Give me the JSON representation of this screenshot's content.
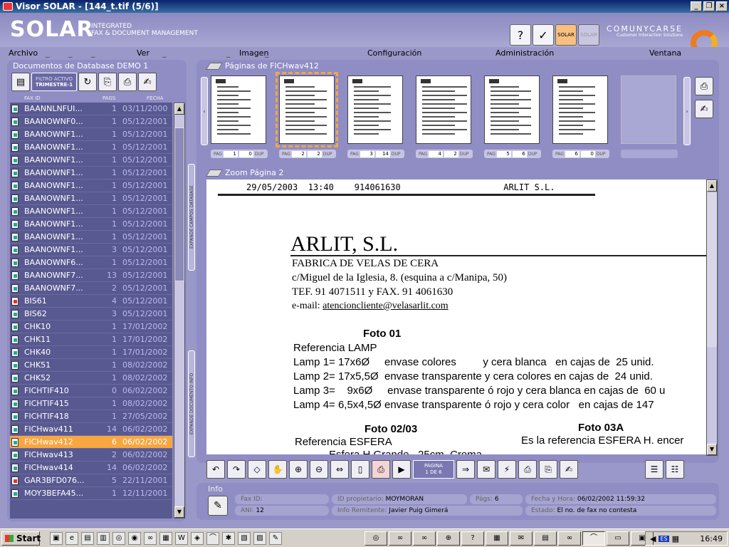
{
  "window": {
    "title": "Visor SOLAR - [144_t.tif (5/6)]"
  },
  "header": {
    "logo": "SOLAR",
    "logo_sub1": "INTEGRATED",
    "logo_sub2": "FAX & DOCUMENT MANAGEMENT",
    "brand": "COMUNYCARSE",
    "brand_sub": "Customer Interaction Solutions",
    "tool_icons": [
      "help-icon",
      "check-icon",
      "solar-icon",
      "solar-disabled-icon"
    ],
    "tool_label": "SOLAR"
  },
  "menu": [
    "Archivo",
    "Ver",
    "Imagen",
    "Configuración",
    "Administración",
    "Ventana"
  ],
  "left": {
    "title": "Documentos de Database DEMO 1",
    "filter_label": "FILTRO ACTIVO",
    "filter_value": "TRIMESTRE-1",
    "col_id": "FAX ID",
    "col_pages": "PAGS",
    "col_date": "FECHA",
    "expand_db": "EXPANDE CAMPOS DATABASE",
    "expand_info": "EXPANDE DOCUMENTO INFO",
    "rows": [
      {
        "name": "BAANNLNFUI...",
        "pages": "1",
        "date": "03/11/2000",
        "red": false
      },
      {
        "name": "BAANOWNF0...",
        "pages": "1",
        "date": "05/12/2001",
        "red": false
      },
      {
        "name": "BAANOWNF1...",
        "pages": "1",
        "date": "05/12/2001",
        "red": false
      },
      {
        "name": "BAANOWNF1...",
        "pages": "1",
        "date": "05/12/2001",
        "red": false
      },
      {
        "name": "BAANOWNF1...",
        "pages": "1",
        "date": "05/12/2001",
        "red": false
      },
      {
        "name": "BAANOWNF1...",
        "pages": "1",
        "date": "05/12/2001",
        "red": false
      },
      {
        "name": "BAANOWNF1...",
        "pages": "1",
        "date": "05/12/2001",
        "red": false
      },
      {
        "name": "BAANOWNF1...",
        "pages": "1",
        "date": "05/12/2001",
        "red": false
      },
      {
        "name": "BAANOWNF1...",
        "pages": "1",
        "date": "05/12/2001",
        "red": false
      },
      {
        "name": "BAANOWNF1...",
        "pages": "1",
        "date": "05/12/2001",
        "red": false
      },
      {
        "name": "BAANOWNF1...",
        "pages": "1",
        "date": "05/12/2001",
        "red": false
      },
      {
        "name": "BAANOWNF1...",
        "pages": "3",
        "date": "05/12/2001",
        "red": false
      },
      {
        "name": "BAANOWNF6...",
        "pages": "1",
        "date": "05/12/2001",
        "red": false
      },
      {
        "name": "BAANOWNF7...",
        "pages": "13",
        "date": "05/12/2001",
        "red": false
      },
      {
        "name": "BAANOWNF7...",
        "pages": "2",
        "date": "05/12/2001",
        "red": false
      },
      {
        "name": "BIS61",
        "pages": "4",
        "date": "05/12/2001",
        "red": true
      },
      {
        "name": "BIS62",
        "pages": "3",
        "date": "05/12/2001",
        "red": false
      },
      {
        "name": "CHK10",
        "pages": "1",
        "date": "17/01/2002",
        "red": false
      },
      {
        "name": "CHK11",
        "pages": "1",
        "date": "17/01/2002",
        "red": false
      },
      {
        "name": "CHK40",
        "pages": "1",
        "date": "17/01/2002",
        "red": false
      },
      {
        "name": "CHK51",
        "pages": "1",
        "date": "08/02/2002",
        "red": false
      },
      {
        "name": "CHK52",
        "pages": "1",
        "date": "08/02/2002",
        "red": false
      },
      {
        "name": "FICHTIF410",
        "pages": "0",
        "date": "06/02/2002",
        "red": false
      },
      {
        "name": "FICHTIF415",
        "pages": "1",
        "date": "08/02/2002",
        "red": false
      },
      {
        "name": "FICHTIF418",
        "pages": "1",
        "date": "27/05/2002",
        "red": false
      },
      {
        "name": "FICHwav411",
        "pages": "14",
        "date": "06/02/2002",
        "red": false
      },
      {
        "name": "FICHwav412",
        "pages": "6",
        "date": "06/02/2002",
        "red": false,
        "selected": true
      },
      {
        "name": "FICHwav413",
        "pages": "2",
        "date": "06/02/2002",
        "red": false
      },
      {
        "name": "FICHwav414",
        "pages": "14",
        "date": "06/02/2002",
        "red": false
      },
      {
        "name": "GAR3BFD076...",
        "pages": "5",
        "date": "22/11/2001",
        "red": true
      },
      {
        "name": "MOY3BEFA45...",
        "pages": "1",
        "date": "12/11/2001",
        "red": false
      }
    ]
  },
  "pages": {
    "title": "Páginas de FICHwav412",
    "pag_label": "PAG",
    "dup_label": "DUP",
    "thumbs": [
      {
        "page": "1",
        "dup": "0",
        "selected": false
      },
      {
        "page": "2",
        "dup": "2",
        "selected": true
      },
      {
        "page": "3",
        "dup": "14",
        "selected": false
      },
      {
        "page": "4",
        "dup": "2",
        "selected": false
      },
      {
        "page": "5",
        "dup": "6",
        "selected": false
      },
      {
        "page": "6",
        "dup": "0",
        "selected": false
      }
    ]
  },
  "zoom": {
    "title": "Zoom Página 2",
    "header_line": "29/05/2003  13:40    914061630                    ARLIT S.L.",
    "company": "ARLIT, S.L.",
    "line1": "FABRICA DE VELAS DE CERA",
    "line2": "c/Miguel de la Iglesia, 8. (esquina a c/Manipa, 50)",
    "line3": "TEF. 91 4071511 y  FAX. 91 4061630",
    "line4_label": "e-mail: ",
    "line4_email": "atencioncliente@velasarlit.com",
    "foto1": "Foto 01",
    "ref1": "Referencia LAMP",
    "lamp1": "Lamp 1= 17x6Ø     envase colores         y cera blanca   en cajas de  25 unid.",
    "lamp2": "Lamp 2= 17x5,5Ø  envase transparente y cera colores en cajas de  24 unid.",
    "lamp3": "Lamp 3=    9x6Ø     envase transparente ó rojo y cera blanca en cajas de  60 u",
    "lamp4": "Lamp 4= 6,5x4,5Ø envase transparente ó rojo y cera color   en cajas de 147",
    "foto2": "Foto 02/03",
    "foto3": "Foto 03A",
    "ref2": "Referencia ESFERA",
    "ref3": "Es la referencia ESFERA H. encer",
    "esfera": "Esfera H Grande   25cm  Crema"
  },
  "toolbar": {
    "page_label": "PÁGINA",
    "page_value": "1 DE 6"
  },
  "info": {
    "title": "Info",
    "fax_id_label": "Fax ID:",
    "fax_id": "",
    "owner_label": "ID propietario:",
    "owner": "MOYMORAN",
    "pags_label": "Págs:",
    "pags": "6",
    "date_label": "Fecha y Hora:",
    "date": "06/02/2002 11:59:32",
    "ani_label": "ANI:",
    "ani": "12",
    "sender_label": "Info Remitente:",
    "sender": "Javier Puig Gimerá",
    "state_label": "Estado:",
    "state": "El no. de fax no contesta"
  },
  "taskbar": {
    "start": "Start",
    "lang": "ES",
    "clock": "16:49"
  }
}
